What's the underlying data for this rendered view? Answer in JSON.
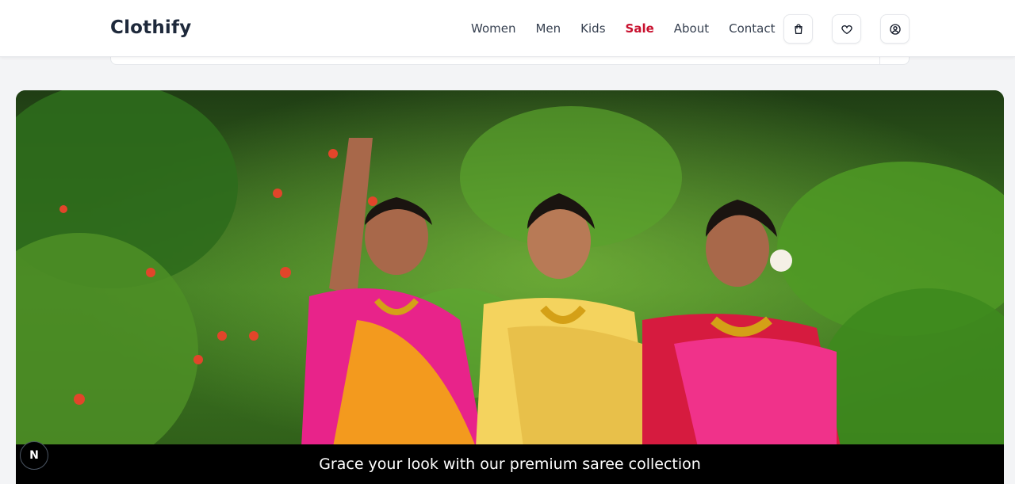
{
  "header": {
    "brand": "Clothify",
    "nav": [
      {
        "label": "Women"
      },
      {
        "label": "Men"
      },
      {
        "label": "Kids"
      },
      {
        "label": "Sale"
      },
      {
        "label": "About"
      },
      {
        "label": "Contact"
      }
    ],
    "icons": [
      "shopping-bag-icon",
      "heart-icon",
      "user-icon"
    ]
  },
  "hero": {
    "caption": "Grace your look with our premium saree collection",
    "image_alt": "Three women in silk sarees in a garden"
  },
  "badge": {
    "letter": "N"
  },
  "colors": {
    "brand": "#1e293b",
    "sale": "#c8102e",
    "caption_bg": "#000000"
  }
}
